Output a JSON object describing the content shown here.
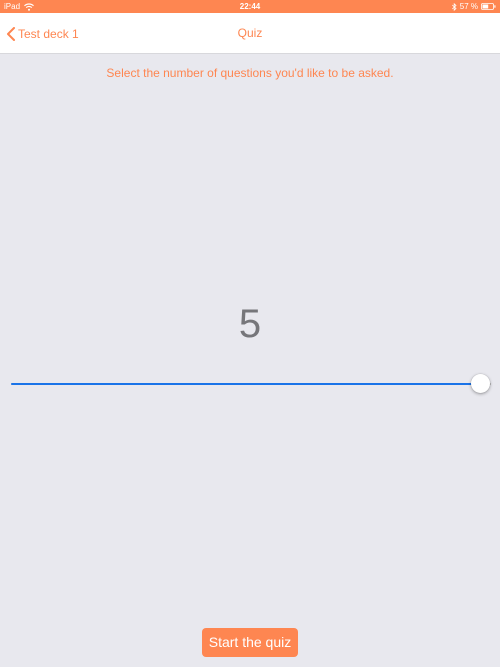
{
  "status_bar": {
    "device": "iPad",
    "time": "22:44",
    "battery_percent": "57 %",
    "battery_level": 0.57
  },
  "nav": {
    "back_label": "Test deck 1",
    "title": "Quiz"
  },
  "main": {
    "instruction": "Select the number of questions you'd like to be asked.",
    "question_count": "5",
    "slider": {
      "min": 1,
      "max": 5,
      "value": 5
    },
    "start_label": "Start the quiz"
  },
  "colors": {
    "accent": "#FE8651",
    "background": "#E8E8EE",
    "slider_fill": "#1A73E8",
    "count_text": "#76767A"
  }
}
